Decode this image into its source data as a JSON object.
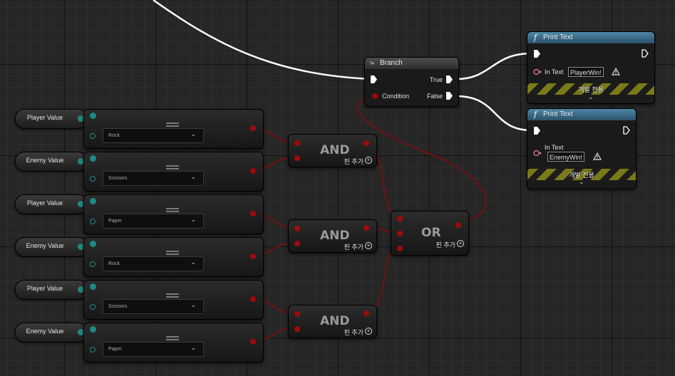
{
  "branch": {
    "title": "Branch",
    "condition_label": "Condition",
    "true_label": "True",
    "false_label": "False"
  },
  "print_nodes": [
    {
      "title": "Print Text",
      "in_text_label": "In Text",
      "in_text_value": "PlayerWin!",
      "dev_only_label": "개발 전용"
    },
    {
      "title": "Print Text",
      "in_text_label": "In Text",
      "in_text_value": "EnemyWin!",
      "dev_only_label": "개발 전용"
    }
  ],
  "variables": [
    {
      "label": "Player Value"
    },
    {
      "label": "Enemy Value"
    },
    {
      "label": "Player Value"
    },
    {
      "label": "Enemy Value"
    },
    {
      "label": "Player Value"
    },
    {
      "label": "Enemy Value"
    }
  ],
  "equal_nodes": [
    {
      "dropdown_value": "Rock"
    },
    {
      "dropdown_value": "Scissors"
    },
    {
      "dropdown_value": "Paper"
    },
    {
      "dropdown_value": "Rock"
    },
    {
      "dropdown_value": "Scissors"
    },
    {
      "dropdown_value": "Paper"
    }
  ],
  "and_nodes": [
    {
      "title": "AND",
      "add_pin_label": "핀 추가"
    },
    {
      "title": "AND",
      "add_pin_label": "핀 추가"
    },
    {
      "title": "AND",
      "add_pin_label": "핀 추가"
    }
  ],
  "or_node": {
    "title": "OR",
    "add_pin_label": "핀 추가"
  },
  "icons": {
    "function": "function-icon",
    "branch": "branch-icon",
    "warning": "warning-icon",
    "dropdown": "chevron-down-icon",
    "add": "add-pin-icon"
  },
  "colors": {
    "background": "#262626",
    "bool_pin": "#9e0b0b",
    "enum_pin": "#1d8a84",
    "function_header": "#4d87a8",
    "text_pin": "#e481a8",
    "warning_stripe": "#7a7a18"
  }
}
